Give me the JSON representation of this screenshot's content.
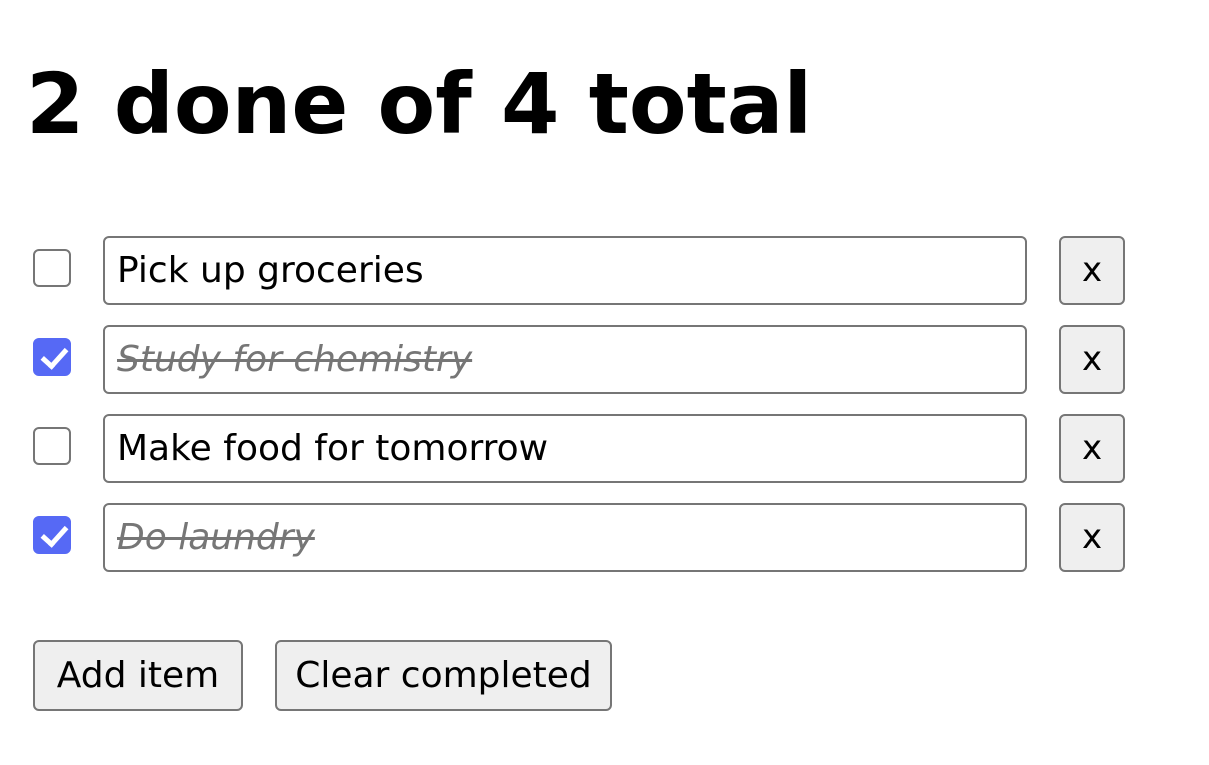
{
  "header": {
    "title": "2 done of 4 total"
  },
  "todos": [
    {
      "text": "Pick up groceries",
      "done": false,
      "remove_label": "x"
    },
    {
      "text": "Study for chemistry",
      "done": true,
      "remove_label": "x"
    },
    {
      "text": "Make food for tomorrow",
      "done": false,
      "remove_label": "x"
    },
    {
      "text": "Do laundry",
      "done": true,
      "remove_label": "x"
    }
  ],
  "actions": {
    "add_label": "Add item",
    "clear_label": "Clear completed"
  },
  "colors": {
    "checkbox_checked": "#5669f5",
    "border": "#767676",
    "button_bg": "#efefef",
    "done_text": "#767676"
  }
}
